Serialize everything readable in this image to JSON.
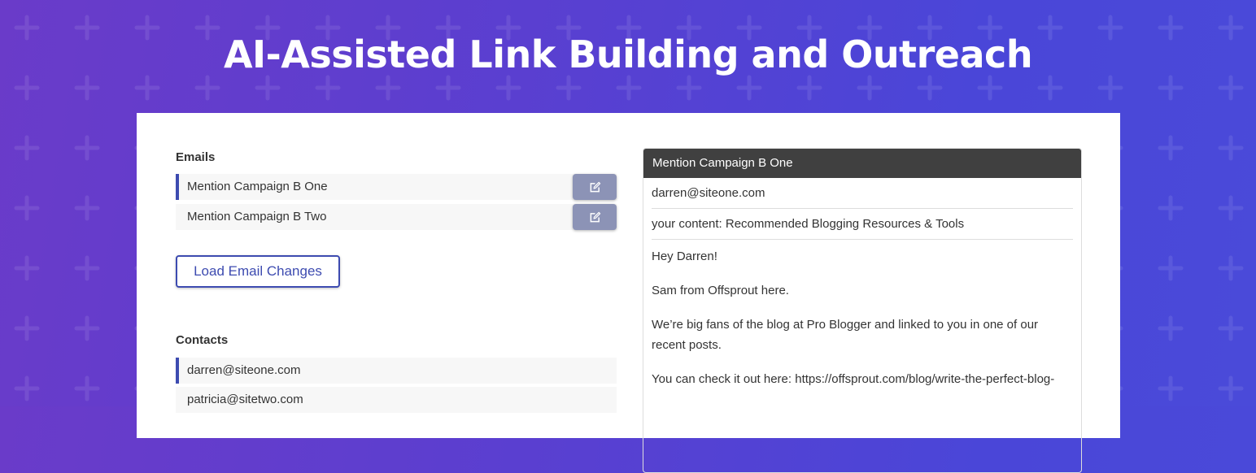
{
  "hero": {
    "title": "AI-Assisted Link Building and Outreach"
  },
  "emails": {
    "label": "Emails",
    "items": [
      {
        "name": "Mention Campaign B One",
        "active": true
      },
      {
        "name": "Mention Campaign B Two",
        "active": false
      }
    ],
    "edit_icon": "edit-icon",
    "load_button_label": "Load Email Changes"
  },
  "contacts": {
    "label": "Contacts",
    "items": [
      {
        "email": "darren@siteone.com",
        "active": true
      },
      {
        "email": "patricia@sitetwo.com",
        "active": false
      }
    ]
  },
  "preview": {
    "title": "Mention Campaign B One",
    "to": "darren@siteone.com",
    "subject": "your content: Recommended Blogging Resources & Tools",
    "paragraphs": [
      "Hey Darren!",
      "Sam from Offsprout here.",
      "We’re big fans of the blog at Pro Blogger and linked to you in one of our recent posts.",
      "You can check it out here: https://offsprout.com/blog/write-the-perfect-blog-"
    ]
  },
  "colors": {
    "accent": "#3d4bb0",
    "edit_button": "#8c93b6",
    "preview_header": "#404040",
    "background_start": "#6a3bc9",
    "background_end": "#4a4ad9"
  }
}
